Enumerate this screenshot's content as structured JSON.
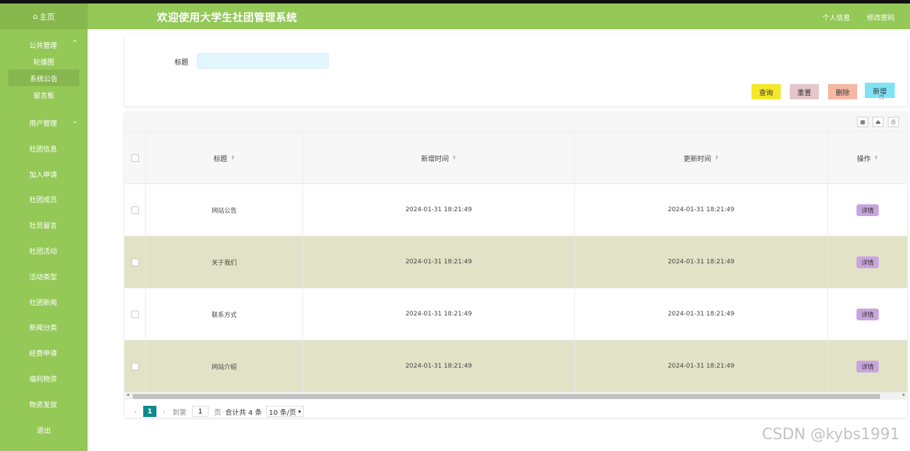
{
  "header": {
    "title": "欢迎使用大学生社团管理系统",
    "profile_link": "个人信息",
    "change_password_link": "修改密码"
  },
  "sidebar": {
    "home": "主页",
    "groups": [
      {
        "label": "公共管理",
        "items": [
          "轮播图",
          "系统公告",
          "留言板"
        ],
        "active_item": "系统公告"
      },
      {
        "label": "用户管理"
      }
    ],
    "items": [
      "社团信息",
      "加入申请",
      "社团成员",
      "社员留言",
      "社团活动",
      "活动类型",
      "社团新闻",
      "新闻分类",
      "经费申请",
      "福利物资",
      "物资发放",
      "退出"
    ]
  },
  "search": {
    "label": "标题",
    "value": "",
    "buttons": {
      "query": "查询",
      "reset": "重置",
      "delete": "删除",
      "add": "新增"
    }
  },
  "table": {
    "columns": [
      "标题",
      "新增时间",
      "更新时间",
      "操作"
    ],
    "rows": [
      {
        "title": "网站公告",
        "created": "2024-01-31 18:21:49",
        "updated": "2024-01-31 18:21:49",
        "action": "详情"
      },
      {
        "title": "关于我们",
        "created": "2024-01-31 18:21:49",
        "updated": "2024-01-31 18:21:49",
        "action": "详情"
      },
      {
        "title": "联系方式",
        "created": "2024-01-31 18:21:49",
        "updated": "2024-01-31 18:21:49",
        "action": "详情"
      },
      {
        "title": "网站介绍",
        "created": "2024-01-31 18:21:49",
        "updated": "2024-01-31 18:21:49",
        "action": "详情"
      }
    ]
  },
  "pagination": {
    "current_page": "1",
    "goto_label": "到第",
    "goto_value": "1",
    "page_suffix": "页",
    "total_text": "合计共 4 条",
    "page_size": "10 条/页"
  },
  "watermark": "CSDN @kybs1991",
  "colors": {
    "theme_green": "#94c857",
    "query_button": "#f5e72a",
    "reset_button": "#e5c7cb",
    "delete_button": "#f5b8a3",
    "add_button": "#7fe3f5",
    "detail_button": "#c9a5df",
    "alt_row": "#e2e2c6",
    "page_active": "#0f8a8a"
  },
  "icons": {
    "home": "home-icon",
    "toolbar": [
      "columns-icon",
      "export-icon",
      "print-icon"
    ]
  }
}
